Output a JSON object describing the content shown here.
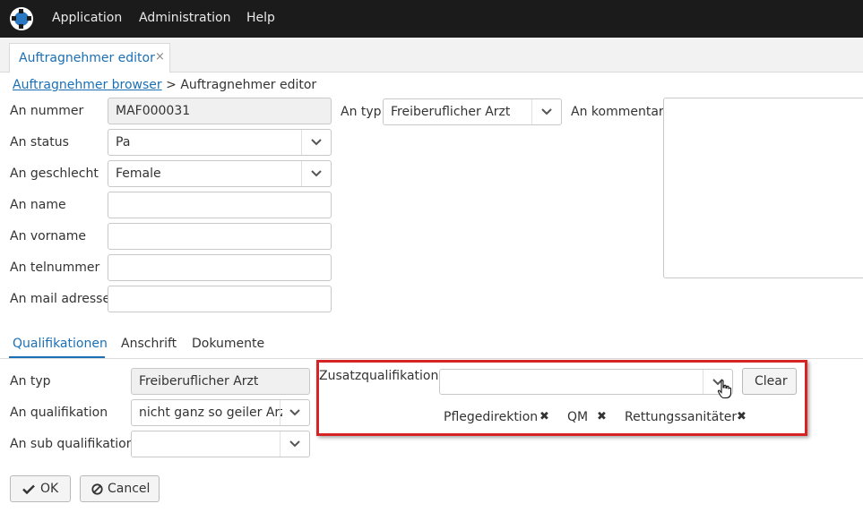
{
  "menu": {
    "application": "Application",
    "administration": "Administration",
    "help": "Help"
  },
  "tab": {
    "title": "Auftragnehmer editor",
    "close": "×"
  },
  "breadcrumb": {
    "link": "Auftragnehmer browser",
    "current": "> Auftragnehmer editor"
  },
  "form": {
    "an_nummer_label": "An nummer",
    "an_nummer_value": "MAF000031",
    "an_status_label": "An status",
    "an_status_value": "Pa",
    "an_geschlecht_label": "An geschlecht",
    "an_geschlecht_value": "Female",
    "an_name_label": "An name",
    "an_vorname_label": "An vorname",
    "an_telnummer_label": "An telnummer",
    "an_mail_label": "An mail adresse",
    "an_typ_label": "An typ",
    "an_typ_value": "Freiberuflicher Arzt",
    "an_kommentar_label": "An kommentar"
  },
  "subtabs": {
    "qualifikationen": "Qualifikationen",
    "anschrift": "Anschrift",
    "dokumente": "Dokumente"
  },
  "qual": {
    "an_typ_label": "An typ",
    "an_typ_value": "Freiberuflicher Arzt",
    "an_qualifikation_label": "An qualifikation",
    "an_qualifikation_value": "nicht ganz so geiler Arzt",
    "an_sub_qualifikation_label": "An sub qualifikation",
    "zusatz_label": "Zusatzqualifikation",
    "clear_label": "Clear",
    "tags": [
      "Pflegedirektion",
      "QM",
      "Rettungssanitäter"
    ],
    "tag_remove": "✖"
  },
  "actions": {
    "ok_label": "OK",
    "cancel_label": "Cancel"
  },
  "colors": {
    "accent": "#1a6fb5",
    "highlight": "#d62424",
    "topbar": "#1b1b1b"
  }
}
